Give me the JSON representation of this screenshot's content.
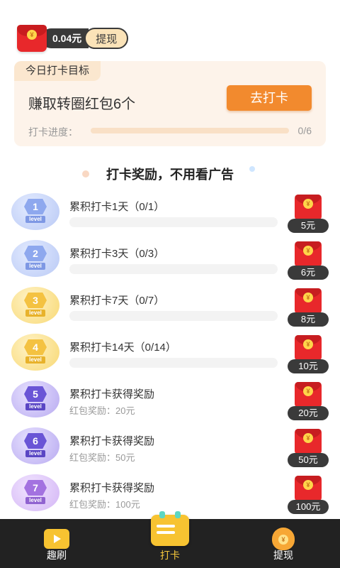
{
  "header": {
    "balance": "0.04元",
    "withdraw_label": "提现",
    "coin_symbol": "¥"
  },
  "goal": {
    "tag": "今日打卡目标",
    "text": "赚取转圈红包6个",
    "button_label": "去打卡",
    "progress_label": "打卡进度：",
    "progress_count": "0/6",
    "progress_fraction": 0
  },
  "section": {
    "heading": "打卡奖励，不用看广告"
  },
  "rewards": [
    {
      "level": "1",
      "level_text": "level",
      "title": "累积打卡1天（0/1）",
      "subtitle": "",
      "amount": "5元",
      "color": "blue"
    },
    {
      "level": "2",
      "level_text": "level",
      "title": "累积打卡3天（0/3）",
      "subtitle": "",
      "amount": "6元",
      "color": "blue"
    },
    {
      "level": "3",
      "level_text": "level",
      "title": "累积打卡7天（0/7）",
      "subtitle": "",
      "amount": "8元",
      "color": "gold"
    },
    {
      "level": "4",
      "level_text": "level",
      "title": "累积打卡14天（0/14）",
      "subtitle": "",
      "amount": "10元",
      "color": "gold"
    },
    {
      "level": "5",
      "level_text": "level",
      "title": "累积打卡获得奖励",
      "subtitle": "红包奖励：20元",
      "amount": "20元",
      "color": "purple"
    },
    {
      "level": "6",
      "level_text": "level",
      "title": "累积打卡获得奖励",
      "subtitle": "红包奖励：50元",
      "amount": "50元",
      "color": "purple"
    },
    {
      "level": "7",
      "level_text": "level",
      "title": "累积打卡获得奖励",
      "subtitle": "红包奖励：100元",
      "amount": "100元",
      "color": "violet"
    }
  ],
  "nav": {
    "items": [
      {
        "label": "趣刷",
        "icon": "tv-icon"
      },
      {
        "label": "打卡",
        "icon": "calendar-icon"
      },
      {
        "label": "提现",
        "icon": "money-bag-icon"
      }
    ],
    "active_index": 1
  },
  "colors": {
    "accent": "#f28a2e",
    "red_packet": "#e8282b",
    "nav_active": "#f6c73b"
  }
}
